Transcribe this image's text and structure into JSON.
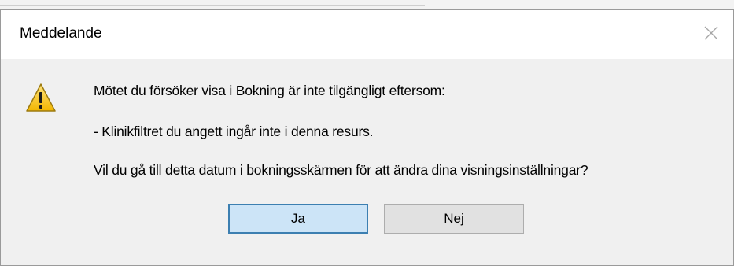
{
  "dialog": {
    "title": "Meddelande",
    "icon": "warning-icon",
    "message_lines": [
      "Mötet du försöker visa i Bokning är inte tilgängligt eftersom:",
      "- Klinikfiltret du angett ingår inte i denna resurs.",
      "Vil du gå till detta datum i bokningsskärmen för att ändra dina visningsinställningar?"
    ],
    "buttons": {
      "yes": {
        "accel": "J",
        "rest": "a"
      },
      "no": {
        "accel": "N",
        "rest": "ej"
      }
    }
  },
  "colors": {
    "default_button_bg": "#cce4f7",
    "default_button_border": "#3c7fb1",
    "button_bg": "#e1e1e1",
    "content_bg": "#f0f0f0"
  }
}
